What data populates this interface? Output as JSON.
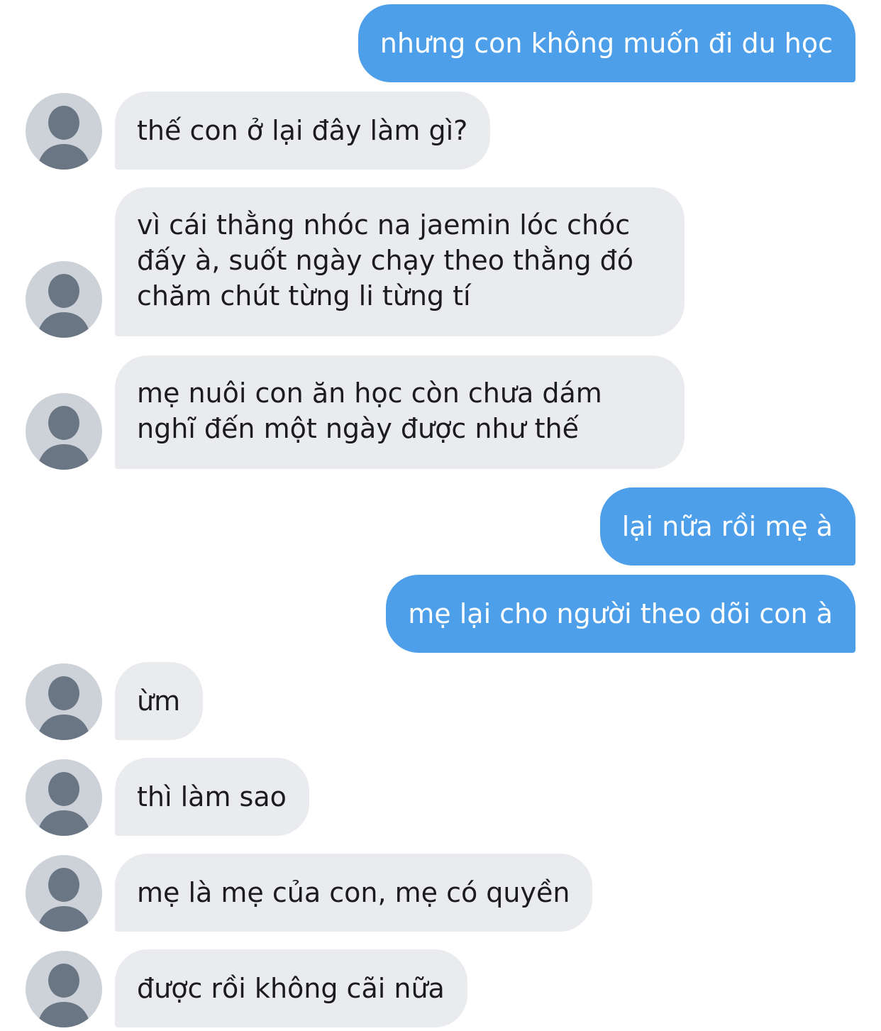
{
  "colors": {
    "outgoing_bubble": "#4e9fe9",
    "incoming_bubble": "#e9ebef",
    "avatar_background": "#cdd2d9",
    "avatar_figure": "#6b7685"
  },
  "messages": [
    {
      "sender": "me",
      "text": "nhưng con không muốn đi du học"
    },
    {
      "sender": "contact",
      "text": "thế con ở lại đây làm gì?"
    },
    {
      "sender": "contact",
      "lines": [
        "vì cái thằng nhóc na jaemin lóc chóc",
        "đấy à, suốt ngày chạy theo thằng đó",
        "chăm chút từng li từng tí"
      ]
    },
    {
      "sender": "contact",
      "lines": [
        "mẹ nuôi con ăn học còn chưa dám",
        "nghĩ đến một ngày được như thế"
      ]
    },
    {
      "sender": "me",
      "text": "lại nữa rồi mẹ à"
    },
    {
      "sender": "me",
      "text": "mẹ lại cho người theo dõi con à"
    },
    {
      "sender": "contact",
      "text": "ừm"
    },
    {
      "sender": "contact",
      "text": "thì làm sao"
    },
    {
      "sender": "contact",
      "text": "mẹ là mẹ của con, mẹ có quyền"
    },
    {
      "sender": "contact",
      "text": "được rồi không cãi nữa"
    }
  ],
  "avatar_icon": "person-silhouette-icon"
}
